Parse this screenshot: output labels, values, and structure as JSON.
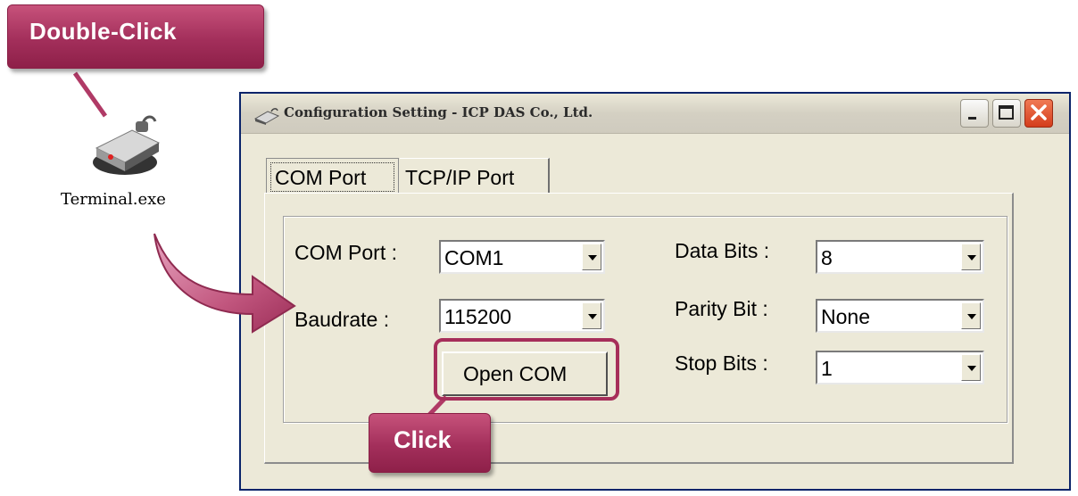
{
  "callouts": {
    "double_click": "Double-Click",
    "click": "Click"
  },
  "desktop": {
    "icon_label": "Terminal.exe",
    "icon": "terminal-modem-icon"
  },
  "window": {
    "title": "Configuration Setting - ICP DAS Co., Ltd.",
    "title_icon": "modem-icon",
    "controls": [
      "minimize-icon",
      "maximize-icon",
      "close-icon"
    ],
    "tabs": [
      {
        "label": "COM Port",
        "selected": true
      },
      {
        "label": "TCP/IP Port",
        "selected": false
      }
    ],
    "fields": {
      "com_port": {
        "label": "COM Port :",
        "value": "COM1"
      },
      "baudrate": {
        "label": "Baudrate :",
        "value": "115200"
      },
      "data_bits": {
        "label": "Data Bits :",
        "value": "8"
      },
      "parity_bit": {
        "label": "Parity Bit :",
        "value": "None"
      },
      "stop_bits": {
        "label": "Stop Bits :",
        "value": "1"
      }
    },
    "open_button": "Open COM"
  },
  "colors": {
    "callout": "#a32f5b",
    "highlight": "#a62e5a",
    "window_face": "#ece9d8",
    "close_button": "#d43d1c"
  }
}
